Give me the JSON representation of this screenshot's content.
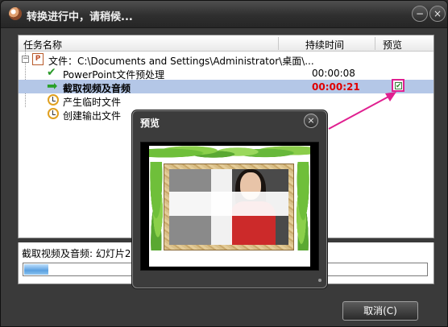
{
  "window": {
    "title": "转换进行中，请稍候...",
    "minimize_glyph": "−",
    "close_glyph": "×"
  },
  "table": {
    "columns": [
      "任务名称",
      "持续时间",
      "预览"
    ],
    "root": {
      "expander": "−",
      "icon": "powerpoint-file-icon",
      "icon_text": "P",
      "label": "文件：C:\\Documents and Settings\\Administrator\\桌面\\..."
    },
    "tasks": [
      {
        "icon": "check-icon",
        "label": "PowerPoint文件预处理",
        "duration": "00:00:08",
        "selected": false
      },
      {
        "icon": "green-arrow-icon",
        "label": "截取视频及音频",
        "duration": "00:00:21",
        "selected": true
      },
      {
        "icon": "clock-icon",
        "label": "产生临时文件",
        "duration": "",
        "selected": false
      },
      {
        "icon": "clock-icon",
        "label": "创建输出文件",
        "duration": "",
        "selected": false
      }
    ],
    "preview_checked": true
  },
  "status": {
    "text": "截取视频及音频: 幻灯片2",
    "progress_percent": 6
  },
  "buttons": {
    "cancel": "取消(C)"
  },
  "preview_window": {
    "title": "预览",
    "close_glyph": "×"
  },
  "colors": {
    "selected_row": "#b4c7e7",
    "duration_active": "#e00000",
    "annotation": "#e02090"
  }
}
